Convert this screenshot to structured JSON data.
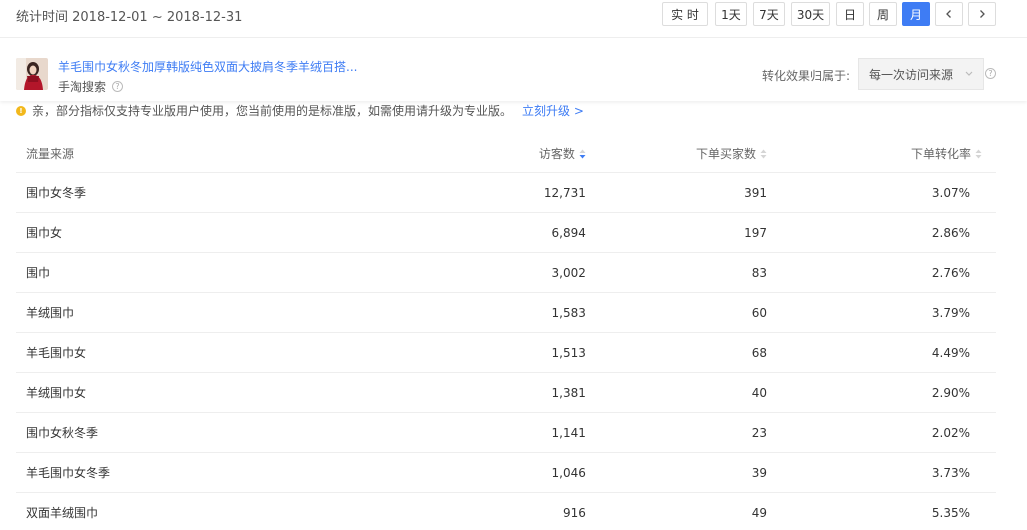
{
  "header": {
    "date_range": "统计时间 2018-12-01 ~ 2018-12-31",
    "period_buttons": [
      {
        "label": "实 时",
        "active": false
      },
      {
        "label": "1天",
        "active": false
      },
      {
        "label": "7天",
        "active": false
      },
      {
        "label": "30天",
        "active": false
      },
      {
        "label": "日",
        "active": false
      },
      {
        "label": "周",
        "active": false
      },
      {
        "label": "月",
        "active": true
      }
    ],
    "accent_color": "#3e7cf4"
  },
  "product": {
    "title": "羊毛围巾女秋冬加厚韩版纯色双面大披肩冬季羊绒百搭...",
    "source": "手淘搜索",
    "attribution_label": "转化效果归属于:",
    "attribution_value": "每一次访问来源"
  },
  "notice": {
    "text": "亲，部分指标仅支持专业版用户使用，您当前使用的是标准版，如需使用请升级为专业版。",
    "link": "立刻升级 >"
  },
  "table": {
    "columns": [
      "流量来源",
      "访客数",
      "下单买家数",
      "下单转化率"
    ],
    "sorted_column": 1,
    "rows": [
      [
        "围巾女冬季",
        "12,731",
        "391",
        "3.07%"
      ],
      [
        "围巾女",
        "6,894",
        "197",
        "2.86%"
      ],
      [
        "围巾",
        "3,002",
        "83",
        "2.76%"
      ],
      [
        "羊绒围巾",
        "1,583",
        "60",
        "3.79%"
      ],
      [
        "羊毛围巾女",
        "1,513",
        "68",
        "4.49%"
      ],
      [
        "羊绒围巾女",
        "1,381",
        "40",
        "2.90%"
      ],
      [
        "围巾女秋冬季",
        "1,141",
        "23",
        "2.02%"
      ],
      [
        "羊毛围巾女冬季",
        "1,046",
        "39",
        "3.73%"
      ],
      [
        "双面羊绒围巾",
        "916",
        "49",
        "5.35%"
      ]
    ]
  }
}
